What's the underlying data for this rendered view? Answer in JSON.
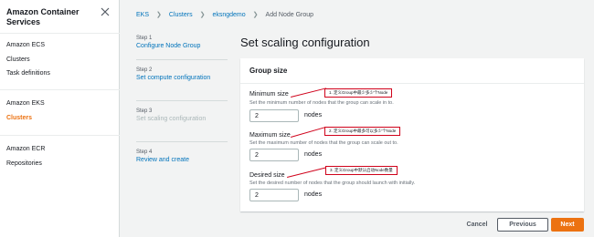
{
  "sidebar": {
    "title": "Amazon Container Services",
    "sections": [
      {
        "items": [
          {
            "label": "Amazon ECS"
          },
          {
            "label": "Clusters"
          },
          {
            "label": "Task definitions"
          }
        ]
      },
      {
        "items": [
          {
            "label": "Amazon EKS"
          },
          {
            "label": "Clusters"
          }
        ]
      },
      {
        "items": [
          {
            "label": "Amazon ECR"
          },
          {
            "label": "Repositories"
          }
        ]
      }
    ]
  },
  "breadcrumb": [
    "EKS",
    "Clusters",
    "eksngdemo",
    "Add Node Group"
  ],
  "steps": [
    {
      "num": "Step 1",
      "label": "Configure Node Group"
    },
    {
      "num": "Step 2",
      "label": "Set compute configuration"
    },
    {
      "num": "Step 3",
      "label": "Set scaling configuration"
    },
    {
      "num": "Step 4",
      "label": "Review and create"
    }
  ],
  "page_title": "Set scaling configuration",
  "panel": {
    "title": "Group size",
    "fields": [
      {
        "label": "Minimum size",
        "description": "Set the minimum number of nodes that the group can scale in to.",
        "value": "2",
        "unit": "nodes",
        "annotation": "1. 定义Group中最少多少个Node"
      },
      {
        "label": "Maximum size",
        "description": "Set the maximum number of nodes that the group can scale out to.",
        "value": "2",
        "unit": "nodes",
        "annotation": "2. 定义Group中最多可以多少个Node"
      },
      {
        "label": "Desired size",
        "description": "Set the desired number of nodes that the group should launch with initially.",
        "value": "2",
        "unit": "nodes",
        "annotation": "3. 定义Group中默认启动Node数量"
      }
    ]
  },
  "buttons": {
    "cancel": "Cancel",
    "previous": "Previous",
    "next": "Next"
  },
  "colors": {
    "accent": "#ec7211",
    "link": "#0073bb",
    "annotation": "#d0021b"
  }
}
